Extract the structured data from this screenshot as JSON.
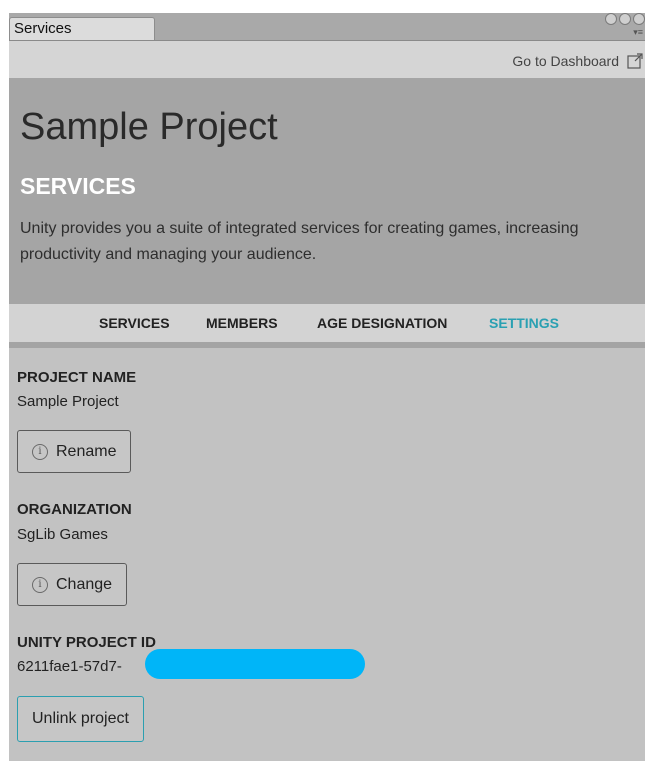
{
  "tab": {
    "title": "Services"
  },
  "toolbar": {
    "dashboard_link": "Go to Dashboard"
  },
  "header": {
    "project_title": "Sample Project",
    "section_heading": "SERVICES",
    "description": "Unity provides you a suite of integrated services for creating games, increasing productivity and managing your audience."
  },
  "nav": {
    "items": [
      {
        "label": "SERVICES"
      },
      {
        "label": "MEMBERS"
      },
      {
        "label": "AGE DESIGNATION"
      },
      {
        "label": "SETTINGS",
        "active": true
      }
    ]
  },
  "settings": {
    "project_name_label": "PROJECT NAME",
    "project_name_value": "Sample Project",
    "rename_button": "Rename",
    "organization_label": "ORGANIZATION",
    "organization_value": "SgLib Games",
    "change_button": "Change",
    "project_id_label": "UNITY PROJECT ID",
    "project_id_value": "6211fae1-57d7-",
    "unlink_button": "Unlink project"
  },
  "colors": {
    "accent": "#2aa0b2",
    "redaction": "#00b5f8"
  },
  "icons": [
    "info-icon",
    "external-link-icon",
    "window-buttons",
    "menu-icon"
  ]
}
